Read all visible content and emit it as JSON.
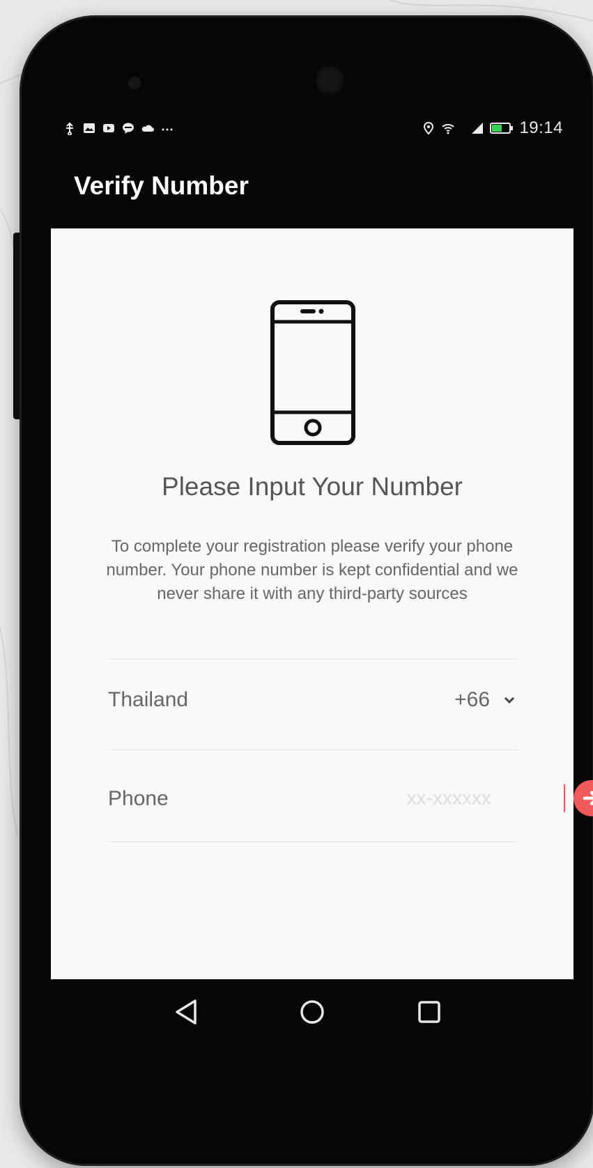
{
  "status_bar": {
    "time": "19:14",
    "left_icons": [
      "usb-icon",
      "gallery-icon",
      "youtube-icon",
      "chat-icon",
      "cloud-icon",
      "more-dots-icon"
    ],
    "right_icons": [
      "location-icon",
      "wifi-icon",
      "signal-icon",
      "battery-icon"
    ]
  },
  "app_bar": {
    "title": "Verify Number"
  },
  "content": {
    "headline": "Please Input Your Number",
    "description": "To complete your registration please verify your phone number. Your phone number is kept confidential and we never share it with any third-party sources",
    "country": {
      "name": "Thailand",
      "code": "+66"
    },
    "phone": {
      "label": "Phone",
      "placeholder": "xx-xxxxxx",
      "value": ""
    }
  },
  "colors": {
    "accent": "#f05a5a",
    "screen_background": "#f9f9f9",
    "frame": "#060606"
  },
  "nav_bar": {
    "buttons": [
      "back-icon",
      "home-icon",
      "recents-icon"
    ]
  }
}
